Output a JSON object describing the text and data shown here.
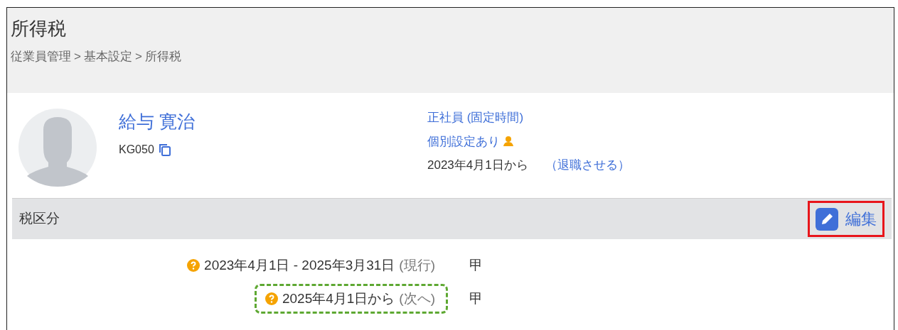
{
  "header": {
    "title": "所得税",
    "breadcrumb": [
      "従業員管理",
      ">",
      "基本設定",
      ">",
      "所得税"
    ]
  },
  "employee": {
    "name": "給与 寛治",
    "code": "KG050",
    "employment_type": "正社員 (固定時間)",
    "custom_setting": "個別設定あり",
    "since": "2023年4月1日から",
    "retire_link": "（退職させる）"
  },
  "section": {
    "title": "税区分",
    "edit_button": {
      "label": "編集",
      "highlighted": true
    },
    "rows": [
      {
        "period": "2023年4月1日 - 2025年3月31日",
        "status": "(現行)",
        "value": "甲",
        "highlighted": false
      },
      {
        "period": "2025年4月1日から",
        "status": "(次へ)",
        "value": "甲",
        "highlighted": true
      }
    ]
  }
}
